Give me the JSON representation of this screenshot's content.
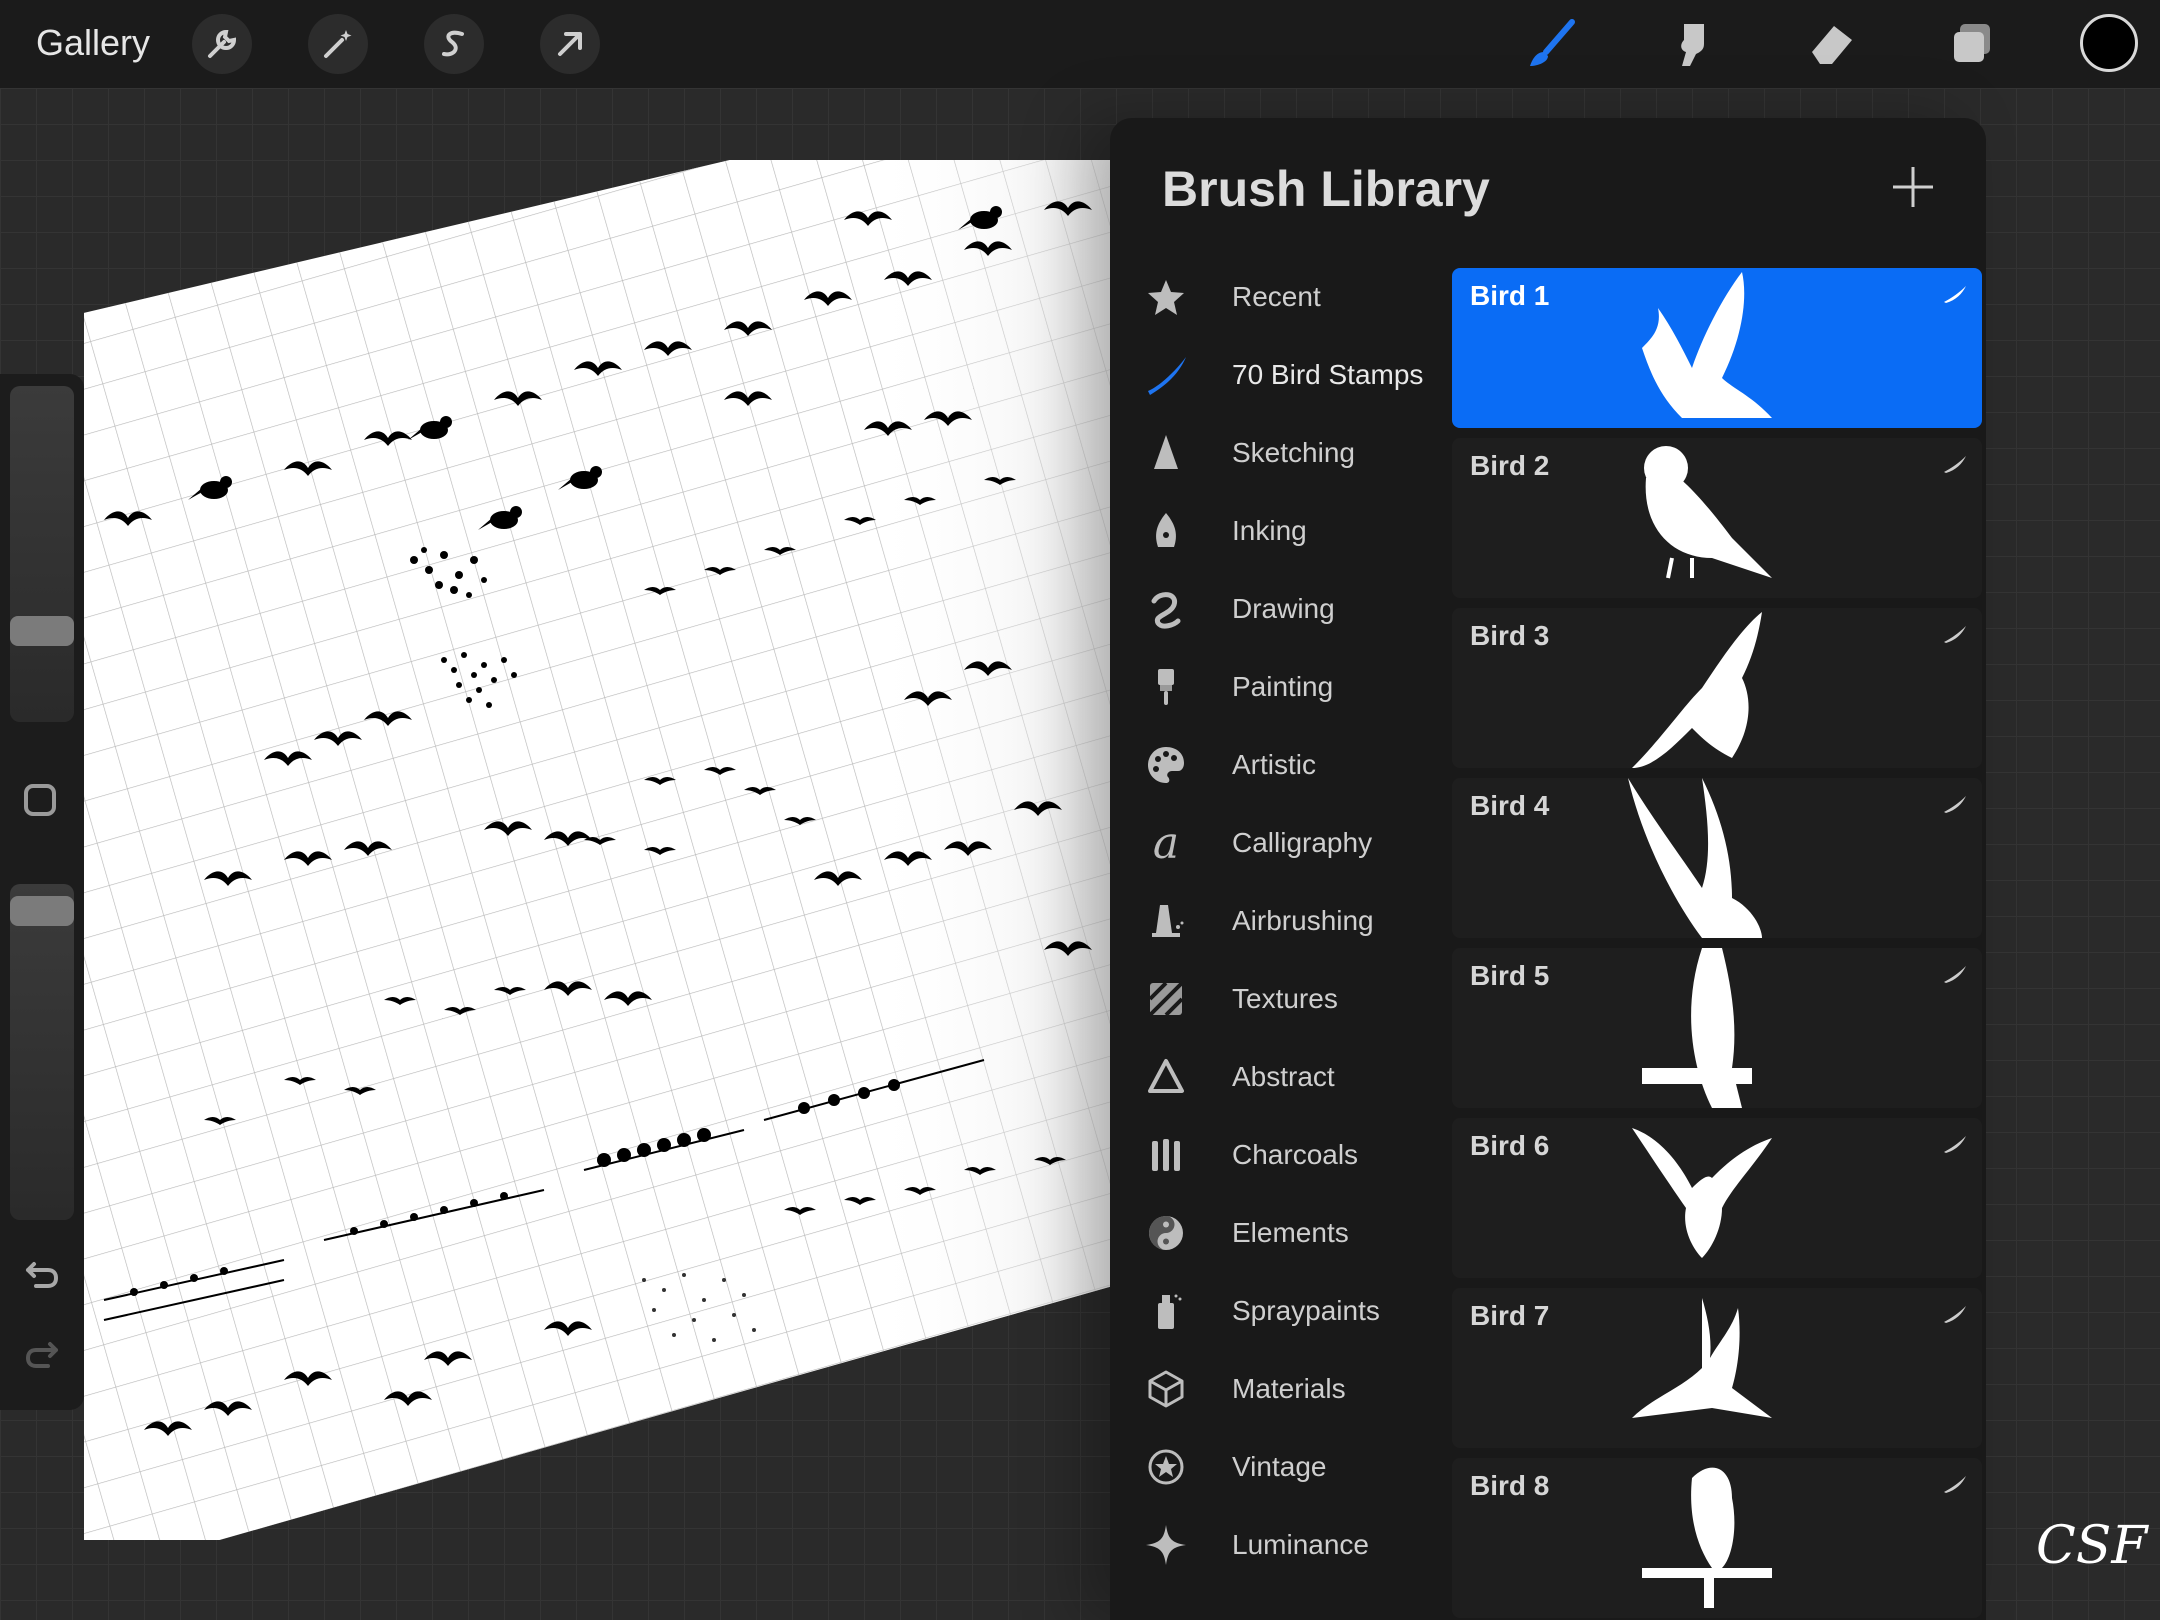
{
  "topbar": {
    "gallery_label": "Gallery",
    "left_tools": [
      "wrench-icon",
      "magic-wand-icon",
      "selection-icon",
      "transform-arrow-icon"
    ],
    "right_tools": [
      "brush-icon",
      "smudge-icon",
      "eraser-icon",
      "layers-icon"
    ],
    "active_tool": "brush",
    "accent_color": "#1e74f0",
    "current_color": "#000000"
  },
  "sidebar": {
    "brush_size_level": 0.7,
    "opacity_level": 0.95
  },
  "panel": {
    "title": "Brush Library",
    "add_label": "+",
    "categories": [
      {
        "label": "Recent",
        "icon": "star-icon"
      },
      {
        "label": "70 Bird Stamps",
        "icon": "stroke-icon",
        "active": true
      },
      {
        "label": "Sketching",
        "icon": "pencil-tip-icon"
      },
      {
        "label": "Inking",
        "icon": "pen-nib-icon"
      },
      {
        "label": "Drawing",
        "icon": "squiggle-icon"
      },
      {
        "label": "Painting",
        "icon": "paint-brush-icon"
      },
      {
        "label": "Artistic",
        "icon": "palette-icon"
      },
      {
        "label": "Calligraphy",
        "icon": "calligraphy-a-icon"
      },
      {
        "label": "Airbrushing",
        "icon": "airbrush-icon"
      },
      {
        "label": "Textures",
        "icon": "texture-icon"
      },
      {
        "label": "Abstract",
        "icon": "triangle-icon"
      },
      {
        "label": "Charcoals",
        "icon": "charcoal-icon"
      },
      {
        "label": "Elements",
        "icon": "yin-yang-icon"
      },
      {
        "label": "Spraypaints",
        "icon": "spray-can-icon"
      },
      {
        "label": "Materials",
        "icon": "cube-icon"
      },
      {
        "label": "Vintage",
        "icon": "vintage-star-icon"
      },
      {
        "label": "Luminance",
        "icon": "sparkle-icon"
      }
    ],
    "brushes": [
      {
        "name": "Bird 1",
        "selected": true
      },
      {
        "name": "Bird 2"
      },
      {
        "name": "Bird 3"
      },
      {
        "name": "Bird 4"
      },
      {
        "name": "Bird 5"
      },
      {
        "name": "Bird 6"
      },
      {
        "name": "Bird 7"
      },
      {
        "name": "Bird 8"
      }
    ]
  },
  "watermark": "CSF"
}
